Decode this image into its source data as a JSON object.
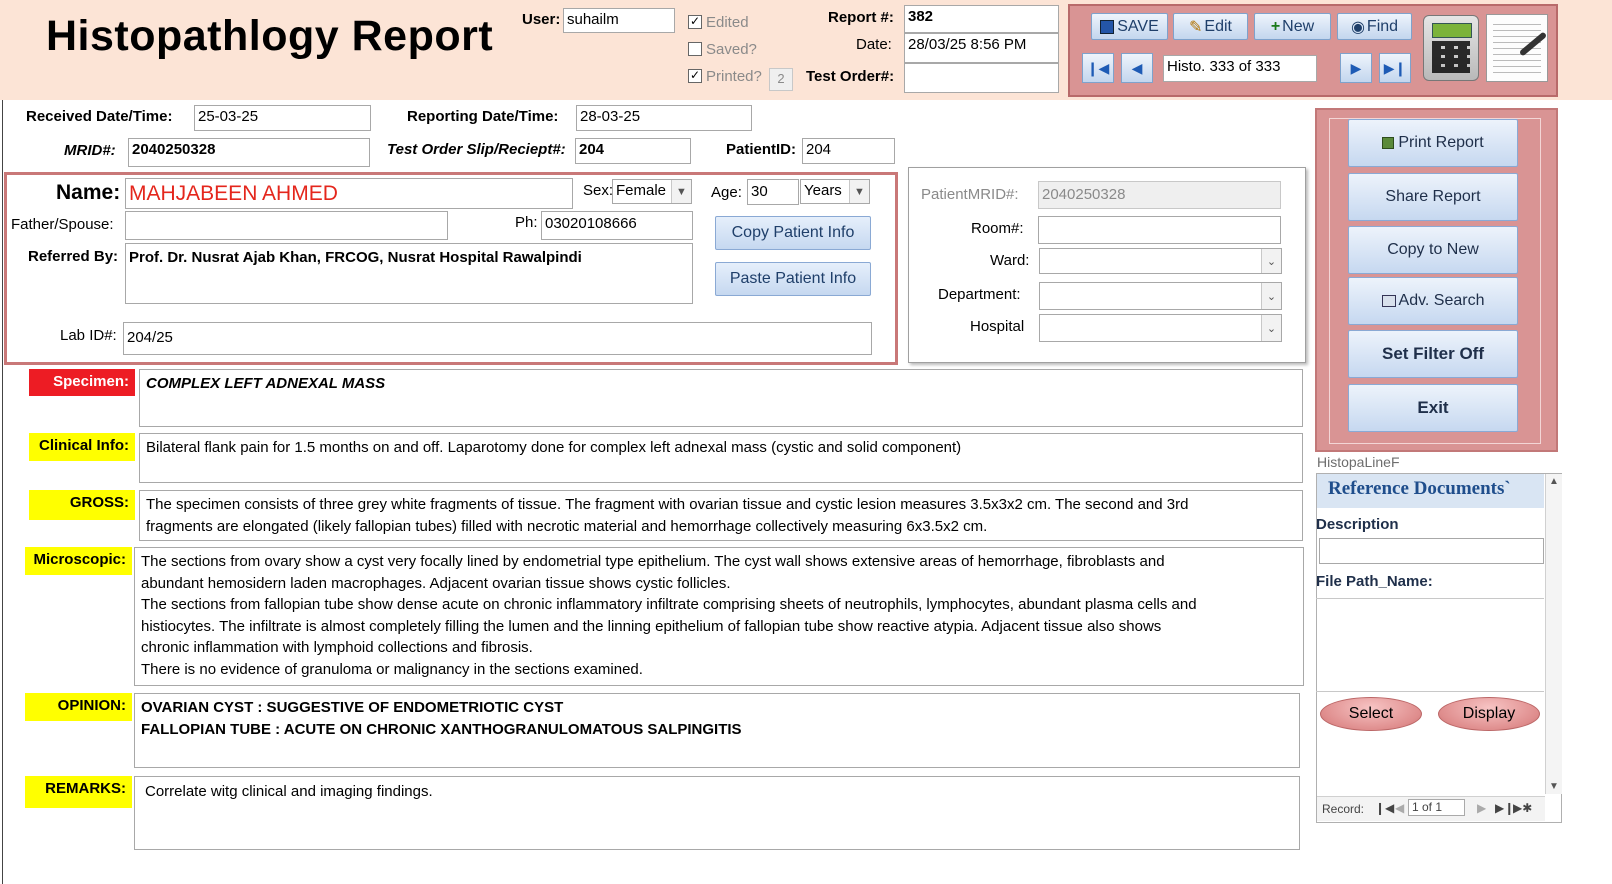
{
  "header": {
    "title": "Histopathlogy Report",
    "user_label": "User:",
    "user_value": "suhailm",
    "edited_label": "Edited",
    "saved_label": "Saved?",
    "printed_label": "Printed?",
    "printed_count": "2",
    "report_no_label": "Report #:",
    "report_no_value": "382",
    "date_label": "Date:",
    "date_value": "28/03/25 8:56 PM",
    "test_order_label": "Test Order#:",
    "test_order_value": ""
  },
  "toolbar": {
    "save": "SAVE",
    "edit": "Edit",
    "new": "New",
    "find": "Find",
    "record_nav": "Histo. 333 of 333"
  },
  "info": {
    "received_label": "Received Date/Time:",
    "received_value": "25-03-25",
    "reporting_label": "Reporting Date/Time:",
    "reporting_value": "28-03-25",
    "mrid_label": "MRID#:",
    "mrid_value": "2040250328",
    "slip_label": "Test Order Slip/Reciept#:",
    "slip_value": "204",
    "patientid_label": "PatientID:",
    "patientid_value": "204"
  },
  "patient": {
    "name_label": "Name:",
    "name_value": "MAHJABEEN AHMED",
    "sex_label": "Sex:",
    "sex_value": "Female",
    "age_label": "Age:",
    "age_value": "30",
    "age_unit": "Years",
    "father_label": "Father/Spouse:",
    "father_value": "",
    "ph_label": "Ph:",
    "ph_value": "03020108666",
    "referred_label": "Referred By:",
    "referred_value": "Prof. Dr. Nusrat Ajab Khan, FRCOG, Nusrat Hospital Rawalpindi",
    "copy_btn": "Copy Patient Info",
    "paste_btn": "Paste Patient Info",
    "labid_label": "Lab ID#:",
    "labid_value": "204/25"
  },
  "hospital": {
    "pmrid_label": "PatientMRID#:",
    "pmrid_value": "2040250328",
    "room_label": "Room#:",
    "room_value": "",
    "ward_label": "Ward:",
    "ward_value": "",
    "dept_label": "Department:",
    "dept_value": "",
    "hospital_label": "Hospital",
    "hospital_value": ""
  },
  "sections": {
    "specimen_label": "Specimen:",
    "specimen_value": "COMPLEX LEFT ADNEXAL MASS",
    "clinical_label": "Clinical Info:",
    "clinical_value": "Bilateral flank pain for 1.5 months on and off. Laparotomy done for complex left adnexal mass (cystic and solid component)",
    "gross_label": "GROSS:",
    "gross_lines": [
      "The specimen consists of  three grey white fragments of tissue. The fragment with ovarian tissue and cystic lesion measures 3.5x3x2 cm. The second and 3rd",
      "fragments are elongated (likely fallopian tubes) filled with necrotic material  and hemorrhage collectively measuring 6x3.5x2 cm."
    ],
    "micro_label": "Microscopic:",
    "micro_lines": [
      "The sections from ovary show a cyst very focally lined by endometrial type epithelium. The cyst wall shows extensive areas of hemorrhage, fibroblasts  and",
      "abundant hemosidern laden macrophages. Adjacent ovarian tissue shows cystic follicles.",
      "The sections from fallopian tube show dense acute on chronic inflammatory infiltrate comprising sheets of neutrophils, lymphocytes, abundant plasma cells and",
      "histiocytes. The infiltrate is almost completely filling the lumen and the linning epithelium of fallopian tube show reactive atypia. Adjacent tissue also shows",
      "chronic inflammation with lymphoid collections and fibrosis.",
      "There is no evidence of granuloma or malignancy in the sections examined."
    ],
    "opinion_label": "OPINION:",
    "opinion_lines": [
      "OVARIAN CYST : SUGGESTIVE OF ENDOMETRIOTIC CYST",
      "FALLOPIAN TUBE : ACUTE ON CHRONIC XANTHOGRANULOMATOUS SALPINGITIS"
    ],
    "remarks_label": "REMARKS:",
    "remarks_value": "Correlate witg clinical and imaging findings."
  },
  "side": {
    "print": "Print Report",
    "share": "Share Report",
    "copy": "Copy to New",
    "adv": "Adv. Search",
    "filter": "Set Filter Off",
    "exit": "Exit"
  },
  "ref": {
    "subform_name": "HistopaLineF",
    "title": "Reference Documents`",
    "desc_label": "Description",
    "path_label": "File Path_Name:",
    "select": "Select",
    "display": "Display",
    "record_label": "Record:",
    "record_value": "1 of 1"
  },
  "colors": {
    "header_bg": "#fce4d6",
    "panel_border": "#c97878",
    "name_red": "#e4261c",
    "tag_yellow": "#ffff00",
    "tag_red": "#ed1c24"
  }
}
